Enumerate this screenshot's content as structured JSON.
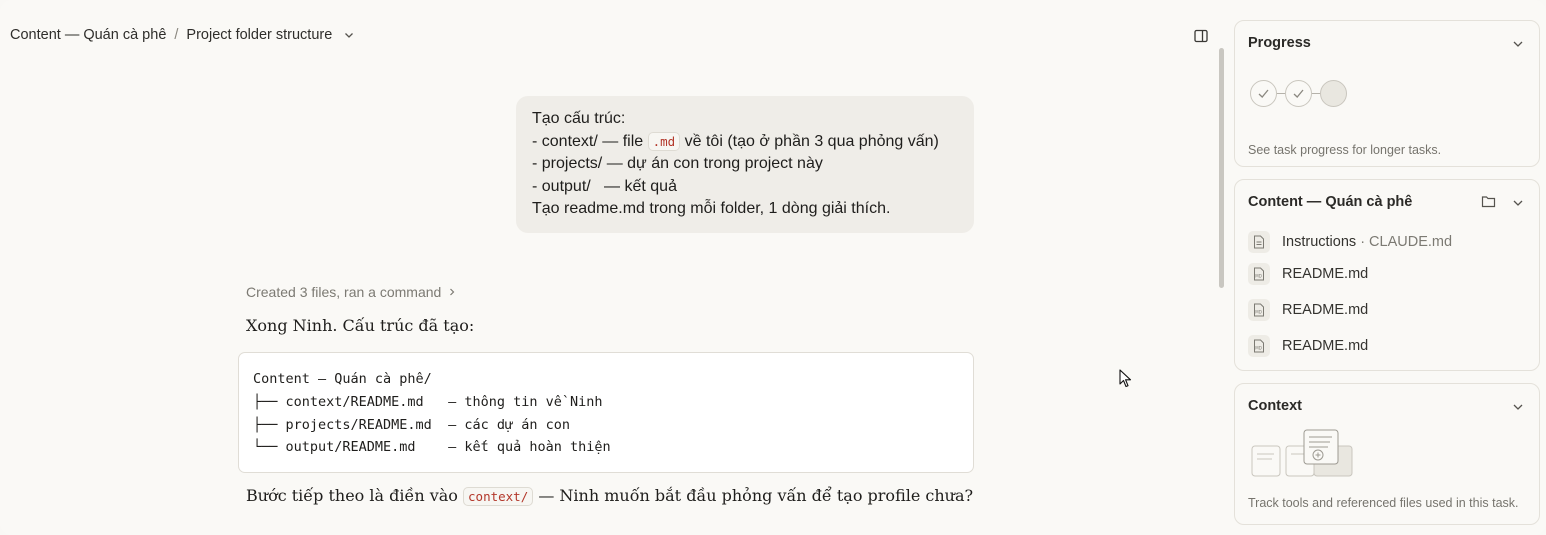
{
  "header": {
    "project": "Content — Quán cà phê",
    "separator": "/",
    "page": "Project folder structure"
  },
  "user_message": {
    "lines": [
      "Tạo cấu trúc:",
      "- context/  — file",
      "về tôi (tạo ở phần 3 qua phỏng vấn)",
      "- projects/ — dự án con trong project này",
      "- output/   — kết quả",
      "Tạo readme.md trong mỗi folder, 1 dòng giải thích."
    ],
    "inline_code": ".md"
  },
  "activity": {
    "label": "Created 3 files, ran a command"
  },
  "reply": {
    "intro": "Xong Ninh. Cấu trúc đã tạo:",
    "code_lines": [
      "Content — Quán cà phê/",
      "├── context/README.md   — thông tin về Ninh",
      "├── projects/README.md  — các dự án con",
      "└── output/README.md    — kết quả hoàn thiện"
    ],
    "next_before": "Bước tiếp theo là điền vào",
    "next_code": "context/",
    "next_after": "— Ninh muốn bắt đầu phỏng vấn để tạo profile chưa?"
  },
  "sidebar": {
    "progress": {
      "title": "Progress",
      "caption": "See task progress for longer tasks.",
      "steps": [
        "done",
        "done",
        "pending"
      ]
    },
    "files": {
      "title": "Content — Quán cà phê",
      "items": [
        {
          "name": "Instructions",
          "sub": "· CLAUDE.md",
          "icon": "document-icon"
        },
        {
          "name": "README.md",
          "sub": "",
          "icon": "md-file-icon"
        },
        {
          "name": "README.md",
          "sub": "",
          "icon": "md-file-icon"
        },
        {
          "name": "README.md",
          "sub": "",
          "icon": "md-file-icon"
        }
      ]
    },
    "context": {
      "title": "Context",
      "caption": "Track tools and referenced files used in this task."
    }
  },
  "colors": {
    "background": "#faf9f6",
    "bubble": "#efede8",
    "inline_code_text": "#b3372a"
  }
}
